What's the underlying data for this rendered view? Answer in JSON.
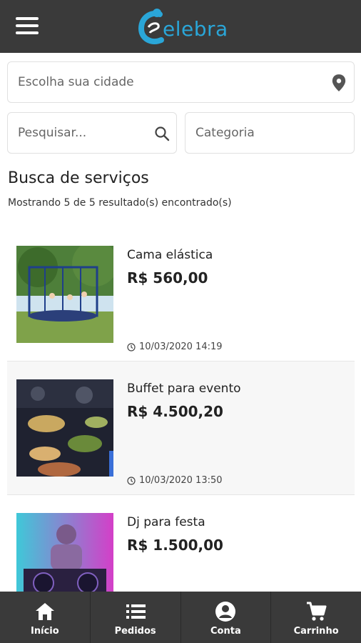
{
  "header": {
    "brand": "elebra",
    "menu_icon": "hamburger-menu-icon",
    "logo_color": "#2aa6d8"
  },
  "filters": {
    "city_placeholder": "Escolha sua cidade",
    "search_placeholder": "Pesquisar...",
    "category_placeholder": "Categoria"
  },
  "main": {
    "title": "Busca de serviços",
    "results_text": "Mostrando 5 de 5 resultado(s) encontrado(s)"
  },
  "items": [
    {
      "name": "Cama elástica",
      "price": "R$ 560,00",
      "date": "10/03/2020 14:19"
    },
    {
      "name": "Buffet para evento",
      "price": "R$ 4.500,20",
      "date": "10/03/2020 13:50"
    },
    {
      "name": "Dj para festa",
      "price": "R$ 1.500,00",
      "date": ""
    }
  ],
  "nav": [
    {
      "label": "Início",
      "icon": "home-icon"
    },
    {
      "label": "Pedidos",
      "icon": "list-icon"
    },
    {
      "label": "Conta",
      "icon": "account-icon"
    },
    {
      "label": "Carrinho",
      "icon": "cart-icon"
    }
  ],
  "colors": {
    "bar": "#3a3a3a",
    "accent": "#2aa6d8",
    "alt_row": "#f7f7f7"
  }
}
